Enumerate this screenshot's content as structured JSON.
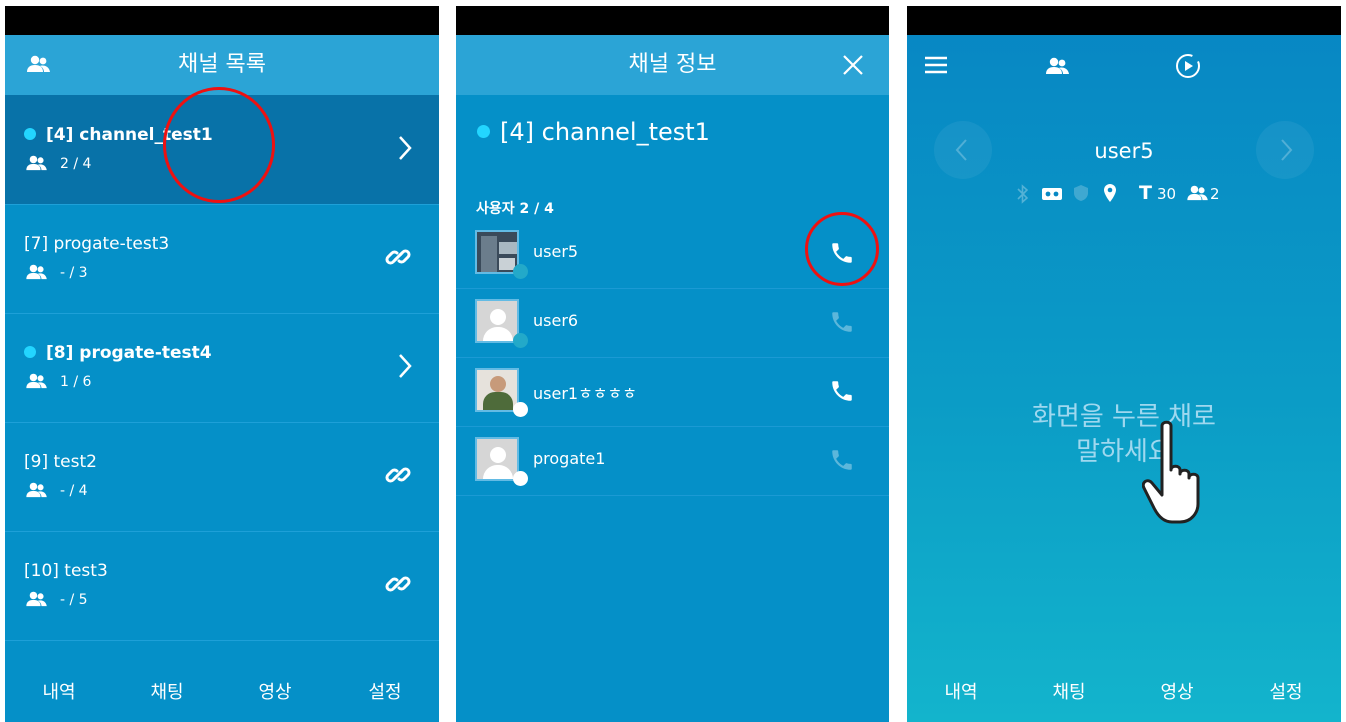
{
  "panel1": {
    "header": {
      "title": "채널 목록"
    },
    "channels": [
      {
        "name": "[4] channel_test1",
        "count": "2 / 4",
        "active": true,
        "action": "chevron"
      },
      {
        "name": "[7] progate-test3",
        "count": "- / 3",
        "active": false,
        "action": "link"
      },
      {
        "name": "[8] progate-test4",
        "count": "1 / 6",
        "active": true,
        "action": "chevron"
      },
      {
        "name": "[9] test2",
        "count": "- / 4",
        "active": false,
        "action": "link"
      },
      {
        "name": "[10] test3",
        "count": "- / 5",
        "active": false,
        "action": "link"
      }
    ],
    "nav": [
      "내역",
      "채팅",
      "영상",
      "설정"
    ]
  },
  "panel2": {
    "header": {
      "title": "채널 정보"
    },
    "channel_name": "[4] channel_test1",
    "users_label": "사용자 2 / 4",
    "users": [
      {
        "name": "user5",
        "online": true,
        "call_active": true
      },
      {
        "name": "user6",
        "online": true,
        "call_active": false
      },
      {
        "name": "user1ㅎㅎㅎㅎ",
        "online": false,
        "call_active": true
      },
      {
        "name": "progate1",
        "online": false,
        "call_active": false
      }
    ]
  },
  "panel3": {
    "username": "user5",
    "status": {
      "t_value": "30",
      "users_value": "2"
    },
    "hint_line1": "화면을 누른 채로",
    "hint_line2": "말하세요",
    "nav": [
      "내역",
      "채팅",
      "영상",
      "설정"
    ]
  },
  "colors": {
    "accent_dot": "#23d5ff",
    "highlight_circle": "#e11111",
    "panel_bg": "#0590c8"
  },
  "icons": [
    "users-icon",
    "chevron-right-icon",
    "link-icon",
    "close-icon",
    "phone-icon",
    "menu-icon",
    "play-circle-icon",
    "hand-pointer-icon",
    "bluetooth-icon",
    "location-icon"
  ]
}
